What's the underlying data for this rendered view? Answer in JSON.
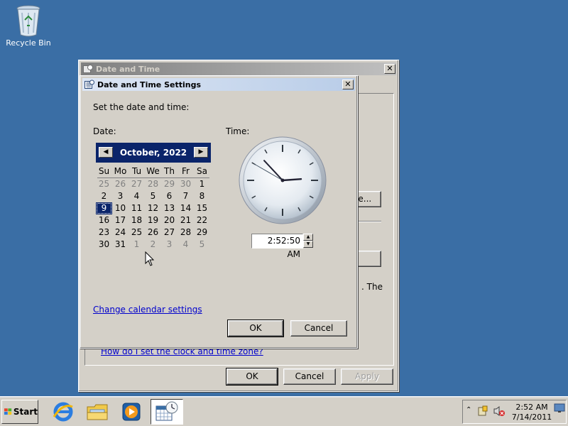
{
  "desktop": {
    "recycle_bin_label": "Recycle Bin"
  },
  "parent_window": {
    "title": "Date and Time",
    "partial_button_label": "ne...",
    "partial_text": ". The",
    "help_link": "How do I set the clock and time zone?",
    "ok_label": "OK",
    "cancel_label": "Cancel",
    "apply_label": "Apply"
  },
  "dialog": {
    "title": "Date and Time Settings",
    "instruction": "Set the date and time:",
    "date_label": "Date:",
    "time_label": "Time:",
    "calendar": {
      "month_year": "October, 2022",
      "prev_icon": "left-arrow-icon",
      "next_icon": "right-arrow-icon",
      "weekdays": [
        "Su",
        "Mo",
        "Tu",
        "We",
        "Th",
        "Fr",
        "Sa"
      ],
      "weeks": [
        [
          {
            "d": "25",
            "o": true
          },
          {
            "d": "26",
            "o": true
          },
          {
            "d": "27",
            "o": true
          },
          {
            "d": "28",
            "o": true
          },
          {
            "d": "29",
            "o": true
          },
          {
            "d": "30",
            "o": true
          },
          {
            "d": "1",
            "o": false
          }
        ],
        [
          {
            "d": "2",
            "o": false
          },
          {
            "d": "3",
            "o": false
          },
          {
            "d": "4",
            "o": false
          },
          {
            "d": "5",
            "o": false
          },
          {
            "d": "6",
            "o": false
          },
          {
            "d": "7",
            "o": false
          },
          {
            "d": "8",
            "o": false
          }
        ],
        [
          {
            "d": "9",
            "o": false,
            "sel": true
          },
          {
            "d": "10",
            "o": false
          },
          {
            "d": "11",
            "o": false
          },
          {
            "d": "12",
            "o": false
          },
          {
            "d": "13",
            "o": false
          },
          {
            "d": "14",
            "o": false
          },
          {
            "d": "15",
            "o": false
          }
        ],
        [
          {
            "d": "16",
            "o": false
          },
          {
            "d": "17",
            "o": false
          },
          {
            "d": "18",
            "o": false
          },
          {
            "d": "19",
            "o": false
          },
          {
            "d": "20",
            "o": false
          },
          {
            "d": "21",
            "o": false
          },
          {
            "d": "22",
            "o": false
          }
        ],
        [
          {
            "d": "23",
            "o": false
          },
          {
            "d": "24",
            "o": false
          },
          {
            "d": "25",
            "o": false
          },
          {
            "d": "26",
            "o": false
          },
          {
            "d": "27",
            "o": false
          },
          {
            "d": "28",
            "o": false
          },
          {
            "d": "29",
            "o": false
          }
        ],
        [
          {
            "d": "30",
            "o": false
          },
          {
            "d": "31",
            "o": false
          },
          {
            "d": "1",
            "o": true
          },
          {
            "d": "2",
            "o": true
          },
          {
            "d": "3",
            "o": true
          },
          {
            "d": "4",
            "o": true
          },
          {
            "d": "5",
            "o": true
          }
        ]
      ]
    },
    "time_value": "2:52:50 AM",
    "change_calendar_link": "Change calendar settings",
    "ok_label": "OK",
    "cancel_label": "Cancel"
  },
  "taskbar": {
    "start_label": "Start",
    "apps": [
      {
        "name": "internet-explorer-icon"
      },
      {
        "name": "file-explorer-icon"
      },
      {
        "name": "media-player-icon"
      },
      {
        "name": "date-time-icon"
      }
    ],
    "clock_time": "2:52 AM",
    "clock_date": "7/14/2011"
  },
  "colors": {
    "desktop": "#3a6ea5",
    "title_active": "#0a246a",
    "link": "#0000cc"
  }
}
